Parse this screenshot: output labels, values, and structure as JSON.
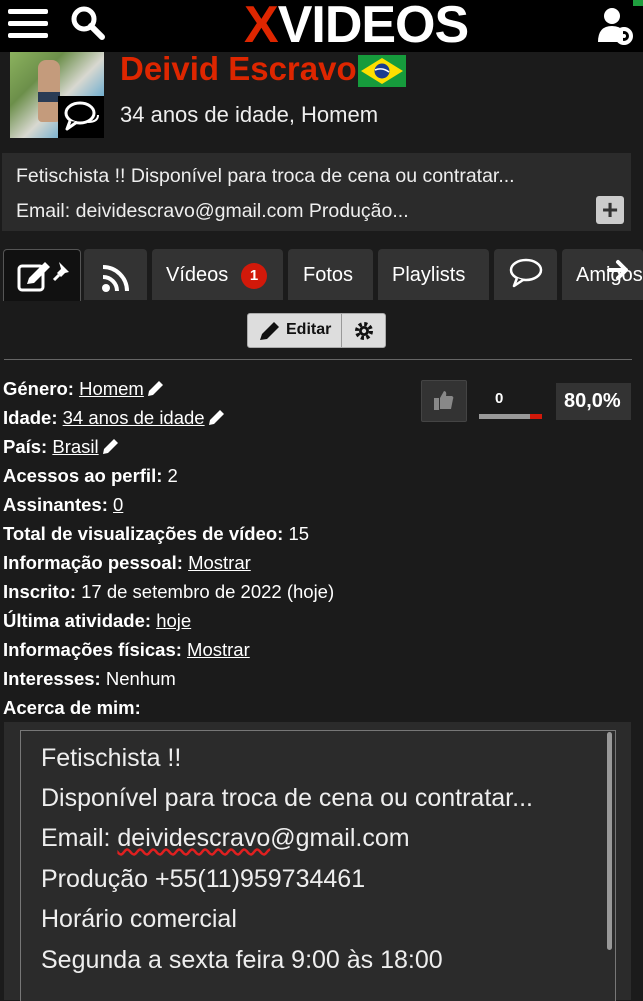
{
  "header": {
    "logo_x": "X",
    "logo_rest": "VIDEOS",
    "icons": [
      "hamburger-icon",
      "search-icon",
      "user-settings-icon"
    ]
  },
  "profile": {
    "name": "Deivid Escravo",
    "age_line": "34 anos de idade, Homem",
    "bio_line1": "Fetischista !! Disponível para troca de cena ou contratar...",
    "bio_line2": "Email: deividescravo@gmail.com Produção...",
    "expand_label": "+"
  },
  "tabs": {
    "videos": "Vídeos",
    "videos_count": "1",
    "fotos": "Fotos",
    "playlists": "Playlists",
    "amigos": "Amigos"
  },
  "toolbar": {
    "edit_label": "Editar"
  },
  "rating": {
    "votes": "0",
    "percent": "80,0%"
  },
  "info": {
    "genero_label": "Género:",
    "genero_value": "Homem",
    "idade_label": "Idade:",
    "idade_value": "34 anos de idade",
    "pais_label": "País:",
    "pais_value": "Brasil",
    "acessos_label": "Acessos ao perfil:",
    "acessos_value": "2",
    "assinantes_label": "Assinantes:",
    "assinantes_value": "0",
    "visualizacoes_label": "Total de visualizações de vídeo:",
    "visualizacoes_value": "15",
    "pessoal_label": "Informação pessoal:",
    "pessoal_value": "Mostrar",
    "inscrito_label": "Inscrito:",
    "inscrito_value": "17 de setembro de 2022 (hoje)",
    "atividade_label": "Última atividade:",
    "atividade_value": "hoje",
    "fisicas_label": "Informações físicas:",
    "fisicas_value": "Mostrar",
    "interesses_label": "Interesses:",
    "interesses_value": "Nenhum",
    "acerca_label": "Acerca de mim:"
  },
  "about": {
    "line1": "Fetischista !!",
    "line2": "Disponível para troca de cena ou contratar...",
    "line3_prefix": "Email: ",
    "line3_email": "deividescravo",
    "line3_suffix": "@gmail.com",
    "line4": "Produção +55(11)959734461",
    "line5": "Horário comercial",
    "line6": "Segunda a sexta feira 9:00 às 18:00"
  },
  "colors": {
    "brand_red": "#de2600",
    "badge_red": "#d2190a",
    "background": "#1b1b1b",
    "panel": "#2b2b2b"
  }
}
